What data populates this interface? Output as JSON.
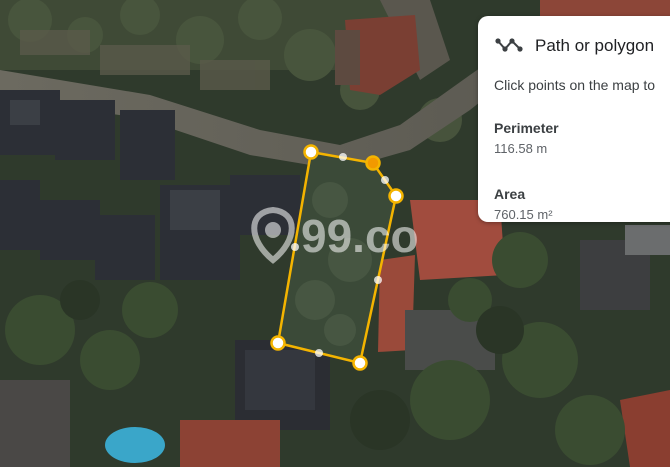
{
  "panel": {
    "title": "Path or polygon",
    "hint": "Click points on the map to",
    "perimeter_label": "Perimeter",
    "perimeter_value": "116.58 m",
    "area_label": "Area",
    "area_value": "760.15 m²",
    "icon": "path-polygon-icon"
  },
  "watermark": {
    "text": "99.co"
  },
  "colors": {
    "polygon_stroke": "#f4b400",
    "vertex_fill": "#ffffff",
    "active_vertex": "#f29900"
  }
}
